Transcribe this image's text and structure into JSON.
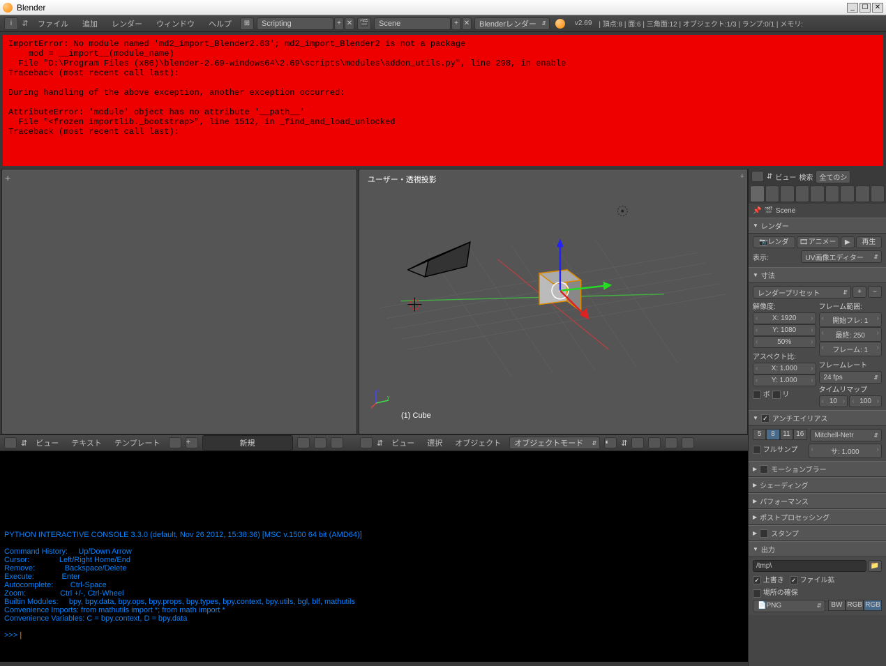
{
  "window": {
    "title": "Blender"
  },
  "topmenu": {
    "items": [
      "ファイル",
      "追加",
      "レンダー",
      "ウィンドウ",
      "ヘルプ"
    ],
    "layout": "Scripting",
    "scene": "Scene",
    "renderer": "Blenderレンダー",
    "version": "v2.69",
    "stats": "頂点:8 | 面:6 | 三角面:12 | オブジェクト:1/3 | ランプ:0/1 | メモリ:"
  },
  "error": "ImportError: No module named 'md2_import_Blender2.63'; md2_import_Blender2 is not a package\n    mod = __import__(module_name)\n  File \"D:\\Program Files (x86)\\blender-2.69-windows64\\2.69\\scripts\\modules\\addon_utils.py\", line 298, in enable\nTraceback (most recent call last):\n\nDuring handling of the above exception, another exception occurred:\n\nAttributeError: 'module' object has no attribute '__path__'\n  File \"<frozen importlib._bootstrap>\", line 1512, in _find_and_load_unlocked\nTraceback (most recent call last):",
  "viewport": {
    "header": "ユーザー・透視投影",
    "object": "(1) Cube",
    "toolbar": {
      "view": "ビュー",
      "select": "選択",
      "object": "オブジェクト",
      "mode": "オブジェクトモード"
    }
  },
  "textEditor": {
    "view": "ビュー",
    "text": "テキスト",
    "template": "テンプレート",
    "new": "新規"
  },
  "properties": {
    "headView": "ビュー",
    "headSearch": "検索",
    "headAll": "全てのシ",
    "scene": "Scene",
    "panels": {
      "render": "レンダー",
      "dimensions": "寸法",
      "antialias": "アンチエイリアス",
      "motionblur": "モーションブラー",
      "shading": "シェーディング",
      "performance": "パフォーマンス",
      "postprocess": "ポストプロセッシング",
      "stamp": "スタンプ",
      "output": "出力"
    },
    "render": {
      "btn1": "レンダ",
      "btn2": "アニメー",
      "btn3": "再生",
      "displayLabel": "表示:",
      "display": "UV画像エディター"
    },
    "dimensions": {
      "preset": "レンダープリセット",
      "resLabel": "解像度:",
      "x": "X: 1920",
      "y": "Y: 1080",
      "pct": "50%",
      "frameLabel": "フレーム範囲:",
      "start": "開始フレ: 1",
      "end": "最終: 250",
      "step": "フレーム: 1",
      "aspectLabel": "アスペクト比:",
      "ax": "X: 1.000",
      "ay": "Y: 1.000",
      "frameRateLabel": "フレームレート",
      "fps": "24 fps",
      "timeRemap": "タイムリマップ",
      "tr1": "10",
      "tr2": "100",
      "bo": "ボ",
      "ri": "リ"
    },
    "aa": {
      "s5": "5",
      "s8": "8",
      "s11": "11",
      "s16": "16",
      "filter": "Mitchell-Netr",
      "fullSample": "フルサンプ",
      "size": "サ: 1.000"
    },
    "output": {
      "path": "/tmp\\",
      "overwrite": "上書き",
      "fileExt": "ファイル拡",
      "placeCheck": "場所の確保",
      "format": "PNG",
      "bw": "BW",
      "rgb": "RGB",
      "rgba": "RGB"
    }
  },
  "console": {
    "header": "PYTHON INTERACTIVE CONSOLE 3.3.0 (default, Nov 26 2012, 15:38:36) [MSC v.1500 64 bit (AMD64)]",
    "help": "Command History:     Up/Down Arrow\nCursor:              Left/Right Home/End\nRemove:              Backspace/Delete\nExecute:             Enter\nAutocomplete:        Ctrl-Space\nZoom:                Ctrl +/-, Ctrl-Wheel\nBuiltin Modules:     bpy, bpy.data, bpy.ops, bpy.props, bpy.types, bpy.context, bpy.utils, bgl, blf, mathutils\nConvenience Imports: from mathutils import *; from math import *\nConvenience Variables: C = bpy.context, D = bpy.data",
    "prompt": ">>> "
  }
}
